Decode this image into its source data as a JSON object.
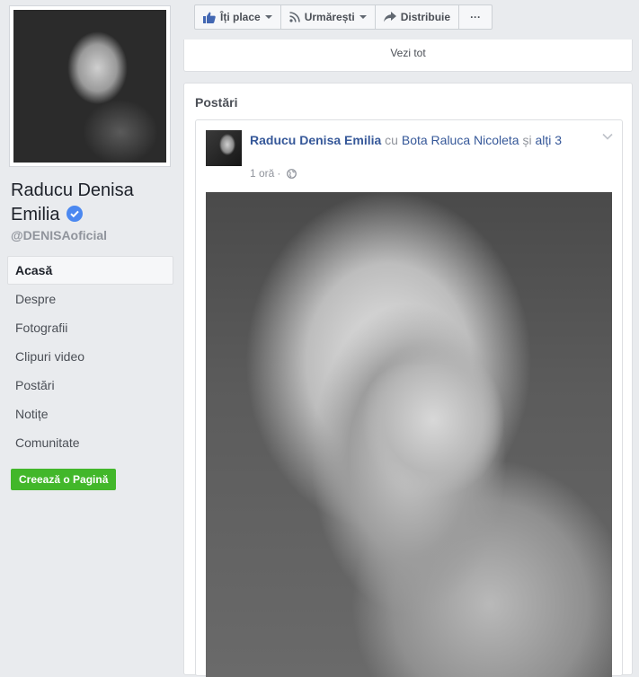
{
  "page": {
    "name": "Raducu Denisa Emilia",
    "handle": "@DENISAoficial",
    "verified": true
  },
  "nav": {
    "items": [
      {
        "label": "Acasă",
        "active": true
      },
      {
        "label": "Despre"
      },
      {
        "label": "Fotografii"
      },
      {
        "label": "Clipuri video"
      },
      {
        "label": "Postări"
      },
      {
        "label": "Notițe"
      },
      {
        "label": "Comunitate"
      }
    ],
    "create_page_label": "Creează o Pagină"
  },
  "actionbar": {
    "like_label": "Îți place",
    "follow_label": "Urmărești",
    "share_label": "Distribuie",
    "more_label": "···"
  },
  "top_card": {
    "see_all_label": "Vezi tot"
  },
  "posts": {
    "title": "Postări",
    "post": {
      "author": "Raducu Denisa Emilia",
      "with_text": "cu",
      "tagged": "Bota Raluca Nicoleta",
      "and_text": "și",
      "others": "alți 3",
      "time": "1 oră",
      "separator": "·"
    }
  },
  "colors": {
    "background": "#e9ebee",
    "link": "#365899",
    "create_button": "#42b72a",
    "verified_badge": "#4b88f0"
  },
  "icons": [
    "thumbs-up-icon",
    "rss-icon",
    "share-arrow-icon",
    "globe-icon",
    "chevron-down-icon",
    "verified-check-icon"
  ]
}
